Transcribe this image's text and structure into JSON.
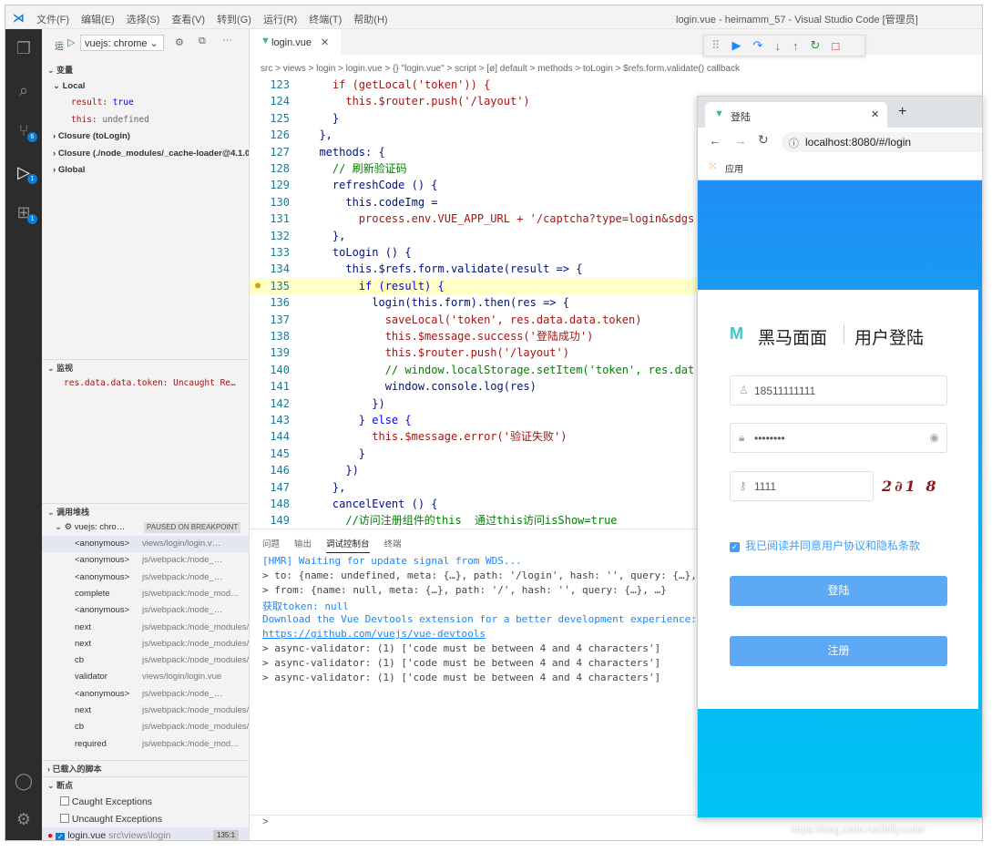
{
  "titlebar": {
    "menus": [
      "文件(F)",
      "编辑(E)",
      "选择(S)",
      "查看(V)",
      "转到(G)",
      "运行(R)",
      "终端(T)",
      "帮助(H)"
    ],
    "window_title": "login.vue - heimamm_57 - Visual Studio Code [管理员]"
  },
  "activity": {
    "badges": [
      "6",
      "1",
      "1"
    ]
  },
  "sidebar": {
    "run_label": "运",
    "config": "vuejs: chrome",
    "variables_title": "变量",
    "local_title": "Local",
    "local_vars": [
      {
        "name": "result:",
        "value": "true"
      },
      {
        "name": "this:",
        "value": "undefined"
      }
    ],
    "closure1": "Closure (toLogin)",
    "closure2": "Closure (./node_modules/_cache-loader@4.1.0",
    "global": "Global",
    "watch_title": "监视",
    "watch_item": "res.data.data.token: Uncaught Re…",
    "callstack_title": "调用堆栈",
    "session": "vuejs: chro…",
    "paused": "PAUSED ON BREAKPOINT",
    "frames": [
      {
        "fn": "<anonymous>",
        "loc": "views/login/login.v…"
      },
      {
        "fn": "<anonymous>",
        "loc": "js/webpack:/node_…"
      },
      {
        "fn": "<anonymous>",
        "loc": "js/webpack:/node_…"
      },
      {
        "fn": "complete",
        "loc": "js/webpack:/node_mod…"
      },
      {
        "fn": "<anonymous>",
        "loc": "js/webpack:/node_…"
      },
      {
        "fn": "next",
        "loc": "js/webpack:/node_modules/…"
      },
      {
        "fn": "next",
        "loc": "js/webpack:/node_modules/…"
      },
      {
        "fn": "cb",
        "loc": "js/webpack:/node_modules/_a…"
      },
      {
        "fn": "validator",
        "loc": "views/login/login.vue"
      },
      {
        "fn": "<anonymous>",
        "loc": "js/webpack:/node_…"
      },
      {
        "fn": "next",
        "loc": "js/webpack:/node_modules/…"
      },
      {
        "fn": "cb",
        "loc": "js/webpack:/node_modules/_a…"
      },
      {
        "fn": "required",
        "loc": "js/webpack:/node_mod…"
      }
    ],
    "loaded_scripts": "已载入的脚本",
    "breakpoints_title": "断点",
    "bp_caught": "Caught Exceptions",
    "bp_uncaught": "Uncaught Exceptions",
    "bp_file": "login.vue",
    "bp_path": "src\\views\\login",
    "bp_line": "135:1"
  },
  "editor": {
    "tab": "login.vue",
    "breadcrumb": "src > views > login > login.vue > {} \"login.vue\" > script > [ø] default > methods > toLogin > $refs.form.validate() callback",
    "lines": [
      {
        "n": "123",
        "t": "    if (getLocal('token')) {"
      },
      {
        "n": "124",
        "t": "      this.$router.push('/layout')"
      },
      {
        "n": "125",
        "t": "    }"
      },
      {
        "n": "126",
        "t": "  },"
      },
      {
        "n": "127",
        "t": "  methods: {"
      },
      {
        "n": "128",
        "t": "    // 刷新验证码"
      },
      {
        "n": "129",
        "t": "    refreshCode () {"
      },
      {
        "n": "130",
        "t": "      this.codeImg ="
      },
      {
        "n": "131",
        "t": "        process.env.VUE_APP_URL + '/captcha?type=login&sdgs"
      },
      {
        "n": "132",
        "t": "    },"
      },
      {
        "n": "133",
        "t": "    toLogin () {"
      },
      {
        "n": "134",
        "t": "      this.$refs.form.validate(result => {"
      },
      {
        "n": "135",
        "t": "        if (result) {"
      },
      {
        "n": "136",
        "t": "          login(this.form).then(res => {"
      },
      {
        "n": "137",
        "t": "            saveLocal('token', res.data.data.token)"
      },
      {
        "n": "138",
        "t": "            this.$message.success('登陆成功')"
      },
      {
        "n": "139",
        "t": "            this.$router.push('/layout')"
      },
      {
        "n": "140",
        "t": "            // window.localStorage.setItem('token', res.dat"
      },
      {
        "n": "141",
        "t": "            window.console.log(res)"
      },
      {
        "n": "142",
        "t": "          })"
      },
      {
        "n": "143",
        "t": "        } else {"
      },
      {
        "n": "144",
        "t": "          this.$message.error('验证失败')"
      },
      {
        "n": "145",
        "t": "        }"
      },
      {
        "n": "146",
        "t": "      })"
      },
      {
        "n": "147",
        "t": "    },"
      },
      {
        "n": "148",
        "t": "    cancelEvent () {"
      },
      {
        "n": "149",
        "t": "      //访问注册组件的this  通过this访问isShow=true"
      }
    ]
  },
  "panel": {
    "tabs": [
      "问题",
      "输出",
      "调试控制台",
      "终端"
    ],
    "lines": [
      {
        "t": "[HMR] Waiting for update signal from WDS...",
        "c": "#1a85ff"
      },
      {
        "t": "> to: {name: undefined, meta: {…}, path: '/login', hash: '', query: {…}, …}",
        "c": "#444"
      },
      {
        "t": "> from: {name: null, meta: {…}, path: '/', hash: '', query: {…}, …}",
        "c": "#444"
      },
      {
        "t": "  获取token: null",
        "c": "#1a85ff"
      },
      {
        "t": "  Download the Vue Devtools extension for a better development experience:",
        "c": "#1a85ff"
      },
      {
        "t": "  https://github.com/vuejs/vue-devtools",
        "c": "#1a85ff"
      },
      {
        "t": "> async-validator: (1) ['code must be between 4 and 4 characters']",
        "c": "#444"
      },
      {
        "t": "> async-validator: (1) ['code must be between 4 and 4 characters']",
        "c": "#444"
      },
      {
        "t": "> async-validator: (1) ['code must be between 4 and 4 characters']",
        "c": "#444"
      }
    ],
    "prompt": ">"
  },
  "browser": {
    "tab_title": "登陆",
    "url": "localhost:8080/#/login",
    "bookmarks": "应用",
    "brand": "黑马面面",
    "heading": "用户登陆",
    "phone": "18511111111",
    "password": "••••••••",
    "code": "1111",
    "captcha": "2∂1 8",
    "agree": "我已阅读并同意用户协议和隐私条款",
    "login_btn": "登陆",
    "register_btn": "注册"
  },
  "watermark": "https://blog.csdn.net/billycoder"
}
